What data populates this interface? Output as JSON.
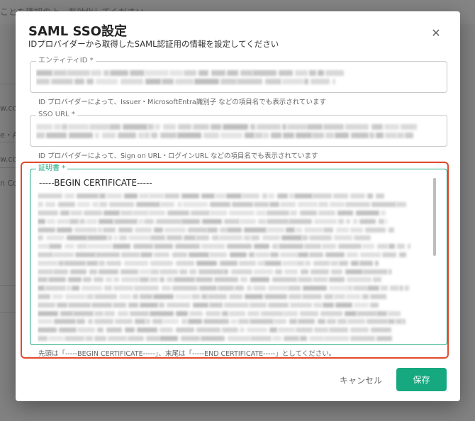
{
  "background": {
    "hint_text": "ことを確認の上、有効化してください",
    "rows": [
      "w.co",
      "e・A",
      "w.co",
      "n Co"
    ]
  },
  "dialog": {
    "title": "SAML SSO設定",
    "subtitle": "IDプロバイダーから取得したSAML認証用の情報を設定してください",
    "close_icon": "close-icon",
    "entity_id": {
      "label": "エンティティID *",
      "helper": "ID プロバイダーによって、Issuer・MicrosoftEntra識別子 などの項目名でも表示されています"
    },
    "sso_url": {
      "label": "SSO URL *",
      "helper": "ID プロバイダーによって、Sign on URL・ログインURL などの項目名でも表示されています"
    },
    "certificate": {
      "label": "証明書 *",
      "first_line": "-----BEGIN CERTIFICATE-----",
      "helper": "先頭は「-----BEGIN CERTIFICATE-----」、末尾は「-----END CERTIFICATE-----」としてください。"
    },
    "buttons": {
      "cancel": "キャンセル",
      "save": "保存"
    }
  },
  "colors": {
    "accent": "#16a97f",
    "highlight": "#e2492d",
    "focus_border": "#1faa83"
  }
}
